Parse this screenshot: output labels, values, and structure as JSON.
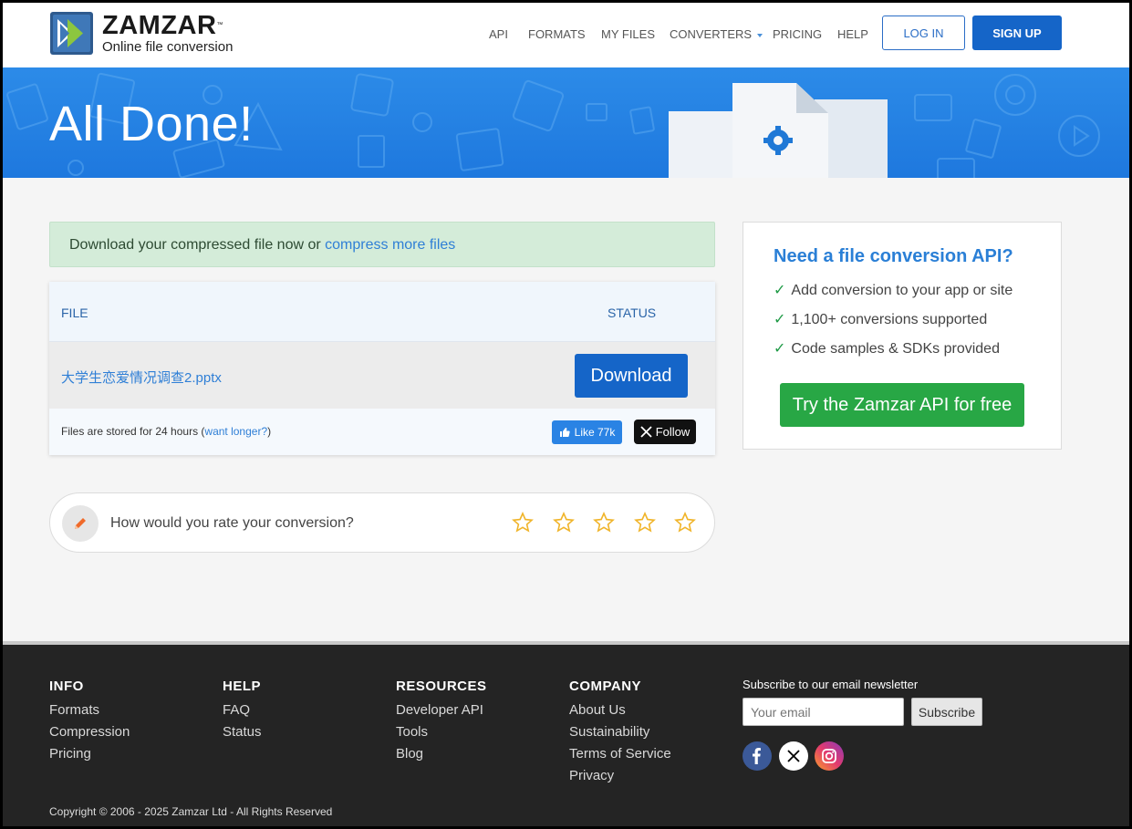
{
  "header": {
    "logo_name": "ZAMZAR",
    "logo_tm": "™",
    "logo_tagline": "Online file conversion",
    "nav": {
      "api": "API",
      "formats": "FORMATS",
      "my_files": "MY FILES",
      "converters": "CONVERTERS",
      "pricing": "PRICING",
      "help": "HELP"
    },
    "login": "LOG IN",
    "signup": "SIGN UP"
  },
  "banner": {
    "title": "All Done!"
  },
  "notice": {
    "text": "Download your compressed file now or ",
    "link": "compress more files"
  },
  "files": {
    "col_file": "FILE",
    "col_status": "STATUS",
    "rows": [
      {
        "name": "大学生恋爱情况调查2.pptx",
        "action": "Download"
      }
    ],
    "store_text": "Files are stored for 24 hours (",
    "store_link": "want longer?",
    "store_end": ")",
    "like": "Like 77k",
    "follow": "Follow"
  },
  "rating": {
    "question": "How would you rate your conversion?",
    "stars": 5,
    "selected": 0
  },
  "api_card": {
    "title": "Need a file conversion API?",
    "items": [
      "Add conversion to your app or site",
      "1,100+ conversions supported",
      "Code samples & SDKs provided"
    ],
    "cta": "Try the Zamzar API for free"
  },
  "footer": {
    "info": {
      "heading": "INFO",
      "links": [
        "Formats",
        "Compression",
        "Pricing"
      ]
    },
    "help": {
      "heading": "HELP",
      "links": [
        "FAQ",
        "Status"
      ]
    },
    "resources": {
      "heading": "RESOURCES",
      "links": [
        "Developer API",
        "Tools",
        "Blog"
      ]
    },
    "company": {
      "heading": "COMPANY",
      "links": [
        "About Us",
        "Sustainability",
        "Terms of Service",
        "Privacy"
      ]
    },
    "newsletter_label": "Subscribe to our email newsletter",
    "email_placeholder": "Your email",
    "subscribe": "Subscribe",
    "copyright": "Copyright © 2006 - 2025 Zamzar Ltd - All Rights Reserved"
  },
  "colors": {
    "brand_blue": "#1565c8",
    "banner_blue": "#2c8be8",
    "api_green": "#28a745",
    "footer_bg": "#242424"
  },
  "icons": [
    "zamzar-logo-icon",
    "gear-icon",
    "pencil-icon",
    "star-icon",
    "thumbs-up-icon",
    "x-logo-icon",
    "facebook-icon",
    "instagram-icon",
    "check-icon"
  ]
}
